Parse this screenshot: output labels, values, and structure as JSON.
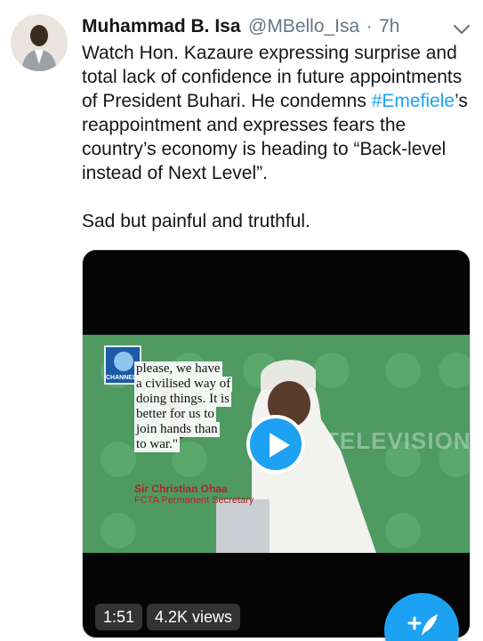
{
  "tweet": {
    "author_name": "Muhammad B. Isa",
    "handle": "@MBello_Isa",
    "separator": "·",
    "time": "7h",
    "text_part1": "Watch Hon. Kazaure expressing surprise and total lack of confidence in future appointments of President Buhari. He condemns ",
    "hashtag": "#Emefiele",
    "text_part2": "’s reappointment and expresses fears the country’s economy is heading to “Back-level instead of Next Level”.",
    "text_line2": "Sad but painful and truthful.",
    "icons": {
      "caret": "chevron-down-icon",
      "play": "play-icon",
      "compose": "compose-tweet-icon"
    }
  },
  "video": {
    "channel_logo_text": "CHANNELS",
    "quote_lines": [
      "please, we have",
      "a civilised way of",
      "doing things. It is",
      "better for us to",
      "join hands than",
      "to war.\""
    ],
    "caption_name": "Sir Christian Ohaa",
    "caption_title": "FCTA Permanent Secretary",
    "watermark": "TELEVISION",
    "duration": "1:51",
    "views": "4.2K views"
  },
  "colors": {
    "accent": "#1da1f2",
    "text": "#14171a",
    "muted": "#657786",
    "frame_green": "#4e9a61"
  }
}
